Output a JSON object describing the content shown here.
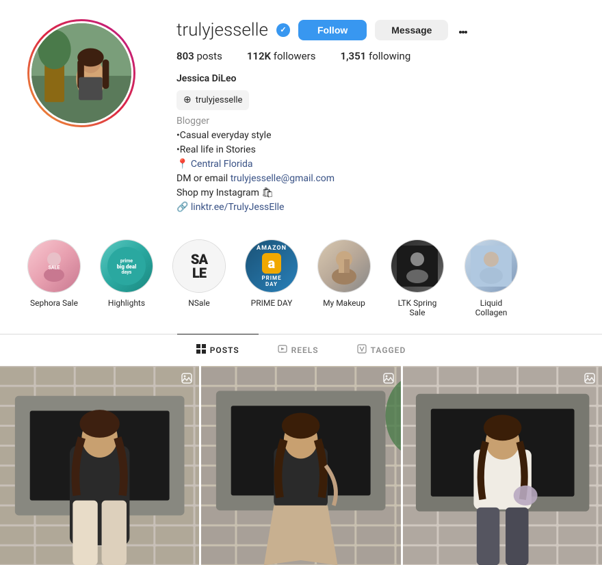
{
  "profile": {
    "username": "trulyjesselle",
    "verified": true,
    "full_name": "Jessica DiLeo",
    "threads_handle": "trulyjesselle",
    "category": "Blogger",
    "bio_lines": [
      "•Casual everyday style",
      "•Real life in Stories"
    ],
    "location": "Central Florida",
    "contact": "DM or email trulyjesselle@gmail.com",
    "shop_text": "Shop my Instagram 🛍",
    "link": "linktr.ee/TrulyJessElle"
  },
  "stats": {
    "posts_count": "803",
    "posts_label": "posts",
    "followers_count": "112K",
    "followers_label": "followers",
    "following_count": "1,351",
    "following_label": "following"
  },
  "buttons": {
    "follow": "Follow",
    "message": "Message"
  },
  "highlights": [
    {
      "id": "sephora",
      "label": "Sephora Sale",
      "style": "sephora"
    },
    {
      "id": "highlights",
      "label": "Highlights",
      "style": "highlights"
    },
    {
      "id": "nsale",
      "label": "NSale",
      "style": "nsale"
    },
    {
      "id": "prime",
      "label": "PRIME DAY",
      "style": "prime"
    },
    {
      "id": "makeup",
      "label": "My Makeup",
      "style": "makeup"
    },
    {
      "id": "ltk",
      "label": "LTK Spring Sale",
      "style": "ltk"
    },
    {
      "id": "collagen",
      "label": "Liquid Collagen",
      "style": "collagen"
    }
  ],
  "tabs": [
    {
      "id": "posts",
      "label": "POSTS",
      "active": true
    },
    {
      "id": "reels",
      "label": "REELS",
      "active": false
    },
    {
      "id": "tagged",
      "label": "TAGGED",
      "active": false
    }
  ]
}
